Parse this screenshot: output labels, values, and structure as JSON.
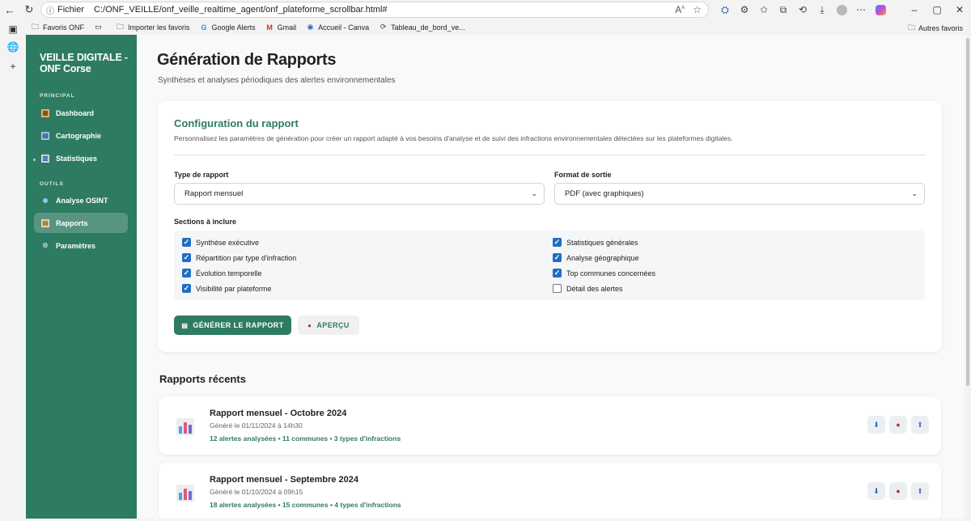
{
  "browser": {
    "file_label": "Fichier",
    "url": "C:/ONF_VEILLE/onf_veille_realtime_agent/onf_plateforme_scrollbar.html#",
    "favorites": [
      {
        "label": "Favoris ONF",
        "icon": "folder-icon"
      },
      {
        "label": "",
        "icon": "reading-list-icon"
      },
      {
        "label": "Importer les favoris",
        "icon": "import-icon"
      },
      {
        "label": "Google Alerts",
        "icon": "google-icon"
      },
      {
        "label": "Gmail",
        "icon": "gmail-icon"
      },
      {
        "label": "Accueil - Canva",
        "icon": "canva-icon"
      },
      {
        "label": "Tableau_de_bord_ve...",
        "icon": "dashboard-icon"
      }
    ],
    "other_favorites": "Autres favoris"
  },
  "sidebar": {
    "brand": "VEILLE DIGITALE - ONF Corse",
    "section_principal": "PRINCIPAL",
    "section_outils": "OUTILS",
    "items": [
      {
        "label": "Dashboard",
        "icon": "dashboard-icon"
      },
      {
        "label": "Cartographie",
        "icon": "map-icon"
      },
      {
        "label": "Statistiques",
        "icon": "chart-icon"
      },
      {
        "label": "Analyse OSINT",
        "icon": "search-dot-icon"
      },
      {
        "label": "Rapports",
        "icon": "report-icon"
      },
      {
        "label": "Paramètres",
        "icon": "gear-icon"
      }
    ],
    "active_item": "Rapports"
  },
  "header": {
    "title": "Génération de Rapports",
    "subtitle": "Synthèses et analyses périodiques des alertes environnementales"
  },
  "config": {
    "title": "Configuration du rapport",
    "description": "Personnalisez les paramètres de génération pour créer un rapport adapté à vos besoins d'analyse et de suivi des infractions environnementales détectées sur les plateformes digitales.",
    "type_label": "Type de rapport",
    "type_value": "Rapport mensuel",
    "format_label": "Format de sortie",
    "format_value": "PDF (avec graphiques)",
    "sections_label": "Sections à inclure",
    "sections": [
      {
        "label": "Synthèse exécutive",
        "checked": true
      },
      {
        "label": "Répartition par type d'infraction",
        "checked": true
      },
      {
        "label": "Évolution temporelle",
        "checked": true
      },
      {
        "label": "Visibilité par plateforme",
        "checked": true
      },
      {
        "label": "Statistiques générales",
        "checked": true
      },
      {
        "label": "Analyse géographique",
        "checked": true
      },
      {
        "label": "Top communes concernées",
        "checked": true
      },
      {
        "label": "Détail des alertes",
        "checked": false
      }
    ],
    "generate_label": "GÉNÉRER LE RAPPORT",
    "preview_label": "APERÇU"
  },
  "recent": {
    "title": "Rapports récents",
    "reports": [
      {
        "title": "Rapport mensuel - Octobre 2024",
        "date": "Généré le 01/11/2024 à 14h30",
        "stats": "12 alertes analysées • 11 communes • 3 types d'infractions"
      },
      {
        "title": "Rapport mensuel - Septembre 2024",
        "date": "Généré le 01/10/2024 à 09h15",
        "stats": "18 alertes analysées • 15 communes • 4 types d'infractions"
      }
    ]
  },
  "colors": {
    "brand_green": "#2e7b63",
    "checkbox_blue": "#1f6ec4"
  }
}
